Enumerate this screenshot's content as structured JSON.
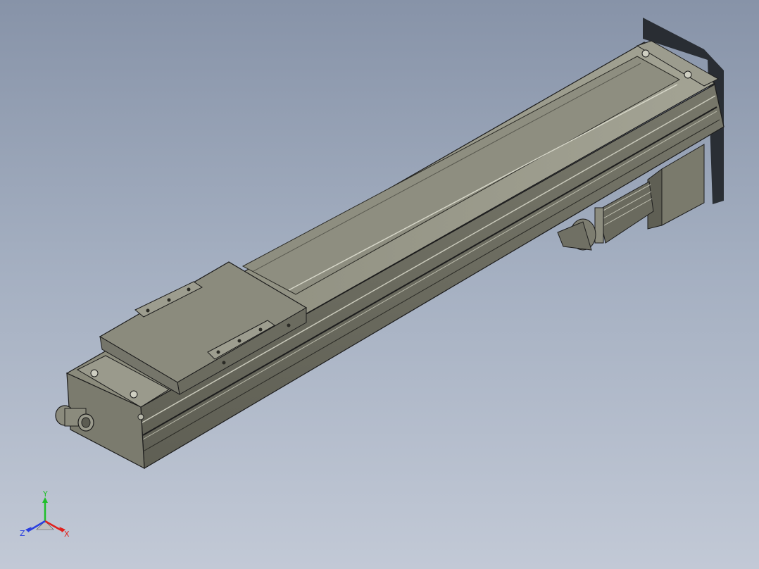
{
  "scene": {
    "background_top": "#8793a8",
    "background_bottom": "#c2c9d6",
    "part_color": "#8f8f80",
    "edge_color": "#1c1c1c"
  },
  "triad": {
    "x_label": "X",
    "y_label": "Y",
    "z_label": "Z",
    "x_color": "#e0201c",
    "y_color": "#1fbf2a",
    "z_color": "#2a3fe0"
  }
}
